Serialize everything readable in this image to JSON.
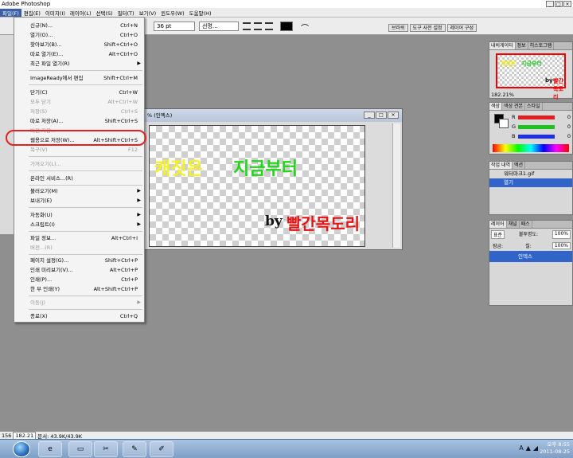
{
  "app": {
    "title": "Adobe Photoshop",
    "window_buttons": [
      "_",
      "□",
      "×"
    ]
  },
  "menubar": {
    "items": [
      "파일(F)",
      "편집(E)",
      "이미지(I)",
      "레이어(L)",
      "선택(S)",
      "필터(T)",
      "보기(V)",
      "윈도우(W)",
      "도움말(H)"
    ],
    "active_index": 0
  },
  "options": {
    "font_size": "36 pt",
    "antialias": "선명...",
    "color_swatch": "#000000",
    "palette_tabs": [
      "브러쉬",
      "도구 사전 설정",
      "레이어 구성"
    ]
  },
  "document": {
    "title": "% (인엑스)",
    "buttons": [
      "_",
      "□",
      "×"
    ],
    "canvas_text": {
      "line1_part1": "캐짓은",
      "line1_part2": "지금부터",
      "line2_part1": "by",
      "line2_part2": "빨간목도리"
    },
    "colors": {
      "yellow": "#f5f21f",
      "green": "#23d61a",
      "black": "#111111",
      "red": "#e51212"
    }
  },
  "file_menu": {
    "items": [
      {
        "label": "신규(N)...",
        "shortcut": "Ctrl+N",
        "disabled": false
      },
      {
        "label": "열기(O)...",
        "shortcut": "Ctrl+O",
        "disabled": false
      },
      {
        "label": "찾아보기(B)...",
        "shortcut": "Shift+Ctrl+O",
        "disabled": false
      },
      {
        "label": "따로 열기(E)...",
        "shortcut": "Alt+Ctrl+O",
        "disabled": false
      },
      {
        "label": "최근 파일 열기(R)",
        "shortcut": "",
        "disabled": false,
        "submenu": true
      },
      {
        "label": "ImageReady에서 편집",
        "shortcut": "Shift+Ctrl+M",
        "disabled": false
      },
      {
        "label": "닫기(C)",
        "shortcut": "Ctrl+W",
        "disabled": false
      },
      {
        "label": "모두 닫기",
        "shortcut": "Alt+Ctrl+W",
        "disabled": true
      },
      {
        "label": "저장(S)",
        "shortcut": "Ctrl+S",
        "disabled": true
      },
      {
        "label": "따로 저장(A)...",
        "shortcut": "Shift+Ctrl+S",
        "disabled": false
      },
      {
        "label": "버전 저장...",
        "shortcut": "",
        "disabled": true
      },
      {
        "label": "웹용으로 저장(W)...",
        "shortcut": "Alt+Shift+Ctrl+S",
        "disabled": false
      },
      {
        "label": "복구(V)",
        "shortcut": "F12",
        "disabled": true
      },
      {
        "label": "가져오기(L)...",
        "shortcut": "",
        "disabled": true
      },
      {
        "label": "온라인 서비스...(R)",
        "shortcut": "",
        "disabled": false
      },
      {
        "label": "불러오기(M)",
        "shortcut": "",
        "disabled": false,
        "submenu": true
      },
      {
        "label": "보내기(E)",
        "shortcut": "",
        "disabled": false,
        "submenu": true
      },
      {
        "label": "자동화(U)",
        "shortcut": "",
        "disabled": false,
        "submenu": true
      },
      {
        "label": "스크립트(I)",
        "shortcut": "",
        "disabled": false,
        "submenu": true
      },
      {
        "label": "파일 정보...",
        "shortcut": "Alt+Ctrl+I",
        "disabled": false
      },
      {
        "label": "버전...(R)",
        "shortcut": "",
        "disabled": true
      },
      {
        "label": "페이지 설정(G)...",
        "shortcut": "Shift+Ctrl+P",
        "disabled": false
      },
      {
        "label": "인쇄 미리보기(V)...",
        "shortcut": "Alt+Ctrl+P",
        "disabled": false
      },
      {
        "label": "인쇄(P)...",
        "shortcut": "Ctrl+P",
        "disabled": false
      },
      {
        "label": "한 부 인쇄(Y)",
        "shortcut": "Alt+Shift+Ctrl+P",
        "disabled": false
      },
      {
        "label": "이동(J)",
        "shortcut": "",
        "disabled": true,
        "submenu": true
      },
      {
        "label": "종료(X)",
        "shortcut": "Ctrl+Q",
        "disabled": false
      }
    ]
  },
  "navigator": {
    "tabs": [
      "내비게이터",
      "정보",
      "히스토그램"
    ],
    "zoom": "182.21%",
    "thumb_text": [
      "캐짓은",
      "지금부터",
      "by",
      "빨간목도리"
    ]
  },
  "color_panel": {
    "tabs": [
      "색상",
      "색상 견본",
      "스타일"
    ],
    "channels": [
      {
        "name": "R",
        "value": "0",
        "bar": "#e02020"
      },
      {
        "name": "G",
        "value": "0",
        "bar": "#20c020"
      },
      {
        "name": "B",
        "value": "0",
        "bar": "#2030e0"
      }
    ]
  },
  "history_panel": {
    "tabs": [
      "작업 내역",
      "액션"
    ],
    "items": [
      "워터마크1.gif",
      "열기"
    ]
  },
  "layers_panel": {
    "tabs": [
      "레이어",
      "채널",
      "패스"
    ],
    "blend_mode": "표준",
    "opacity_label": "불투명도:",
    "opacity": "100%",
    "lock_label": "잠금:",
    "fill_label": "칠:",
    "fill": "100%",
    "layer_name": "인덱스"
  },
  "statusbar": {
    "zoom": "182.21",
    "prefix": "156",
    "doc": "문서: 43.9K/43.9K"
  },
  "taskbar": {
    "time": "오후 8:55",
    "date": "2011-08-25"
  }
}
